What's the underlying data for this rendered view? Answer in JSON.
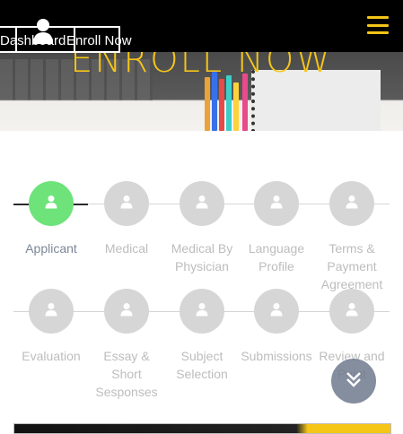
{
  "topbar": {
    "menu_icon": "hamburger-icon",
    "accent": "#f5c518"
  },
  "buttons": {
    "dashboard_label": "Dashboard",
    "enroll_label": "Enroll Now"
  },
  "hero": {
    "title": "ENROLL NOW"
  },
  "steps": {
    "row1": [
      {
        "label": "Applicant",
        "active": true
      },
      {
        "label": "Medical",
        "active": false
      },
      {
        "label": "Medical By Physician",
        "active": false
      },
      {
        "label": "Language Profile",
        "active": false
      },
      {
        "label": "Terms & Payment Agreement",
        "active": false
      }
    ],
    "row2": [
      {
        "label": "Evaluation",
        "active": false
      },
      {
        "label": "Essay & Short Sesponses",
        "active": false
      },
      {
        "label": "Subject Selection",
        "active": false
      },
      {
        "label": "Submissions",
        "active": false
      },
      {
        "label": "Review and Paint",
        "active": false
      }
    ],
    "icon": "user-icon",
    "colors": {
      "active": "#6de37a",
      "inactive": "#d6d6d6",
      "active_label": "#7d8796",
      "inactive_label": "#bdbdbd"
    }
  },
  "scroll_button": {
    "icon": "double-chevron-down-icon"
  }
}
